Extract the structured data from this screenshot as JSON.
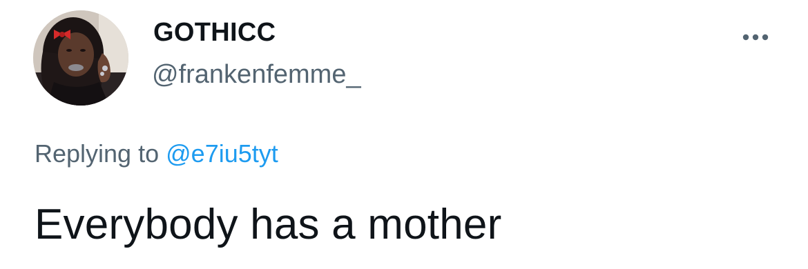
{
  "tweet": {
    "author": {
      "display_name": "GOTHICC",
      "handle": "@frankenfemme_",
      "avatar_icon": "profile-photo"
    },
    "more_icon": "more-horizontal-icon",
    "reply_context": {
      "prefix": "Replying to",
      "mention": "@e7iu5tyt"
    },
    "text": "Everybody has a mother"
  },
  "colors": {
    "text_primary": "#0f1419",
    "text_secondary": "#536471",
    "link": "#1d9bf0",
    "background": "#ffffff"
  }
}
